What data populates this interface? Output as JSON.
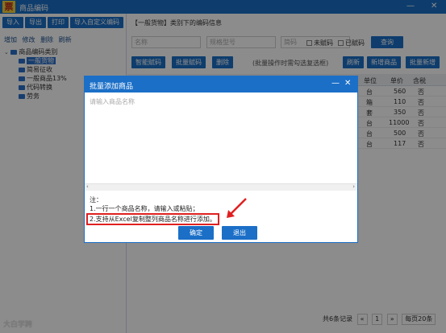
{
  "window": {
    "title": "商品编码",
    "logo_char": "票",
    "minimize": "—",
    "close": "✕"
  },
  "left": {
    "buttons": [
      "导入",
      "导出",
      "打印",
      "导入自定义编码"
    ],
    "links": [
      "增加",
      "修改",
      "删除",
      "刷新"
    ],
    "tree": {
      "root": "商品编码类别",
      "children": [
        "一般货物",
        "简易征收",
        "一般商品13%",
        "代码转换",
        "劳务"
      ],
      "selected_index": 0
    }
  },
  "main": {
    "header_bracket": "【一般货物】",
    "header_suffix": "类别下的编码信息",
    "search": {
      "name_placeholder": "名称",
      "spec_placeholder": "规格型号",
      "short_placeholder": "简码",
      "unassigned": "未赋码",
      "assigned": "已赋码",
      "query_button": "查询"
    },
    "toolbar": {
      "smart": "智能赋码",
      "batch": "批量赋码",
      "delete": "删除",
      "hint": "(批量操作时需勾选复选框)",
      "refresh": "刷新",
      "add": "新增商品",
      "batch_add": "批量新增"
    },
    "table": {
      "headers": [
        "单位",
        "单价",
        "含税"
      ],
      "rows": [
        [
          "台",
          "560",
          "否"
        ],
        [
          "箱",
          "110",
          "否"
        ],
        [
          "套",
          "350",
          "否"
        ],
        [
          "台",
          "11000",
          "否"
        ],
        [
          "台",
          "500",
          "否"
        ],
        [
          "台",
          "117",
          "否"
        ]
      ]
    },
    "pager": {
      "summary": "共6条记录",
      "prev": "«",
      "page": "1",
      "next": "»",
      "per_page": "每页20条"
    }
  },
  "watermark": "大白学跨",
  "dialog": {
    "title": "批量添加商品",
    "min": "—",
    "close": "✕",
    "placeholder": "请输入商品名称",
    "note_title": "注：",
    "note_1": "1.一行一个商品名称，请输入或粘贴；",
    "note_2": "2.支持从Excel复制整列商品名称进行添加。",
    "confirm": "确定",
    "cancel": "退出"
  },
  "colors": {
    "accent": "#1b6fc7",
    "highlight": "#e02020"
  }
}
